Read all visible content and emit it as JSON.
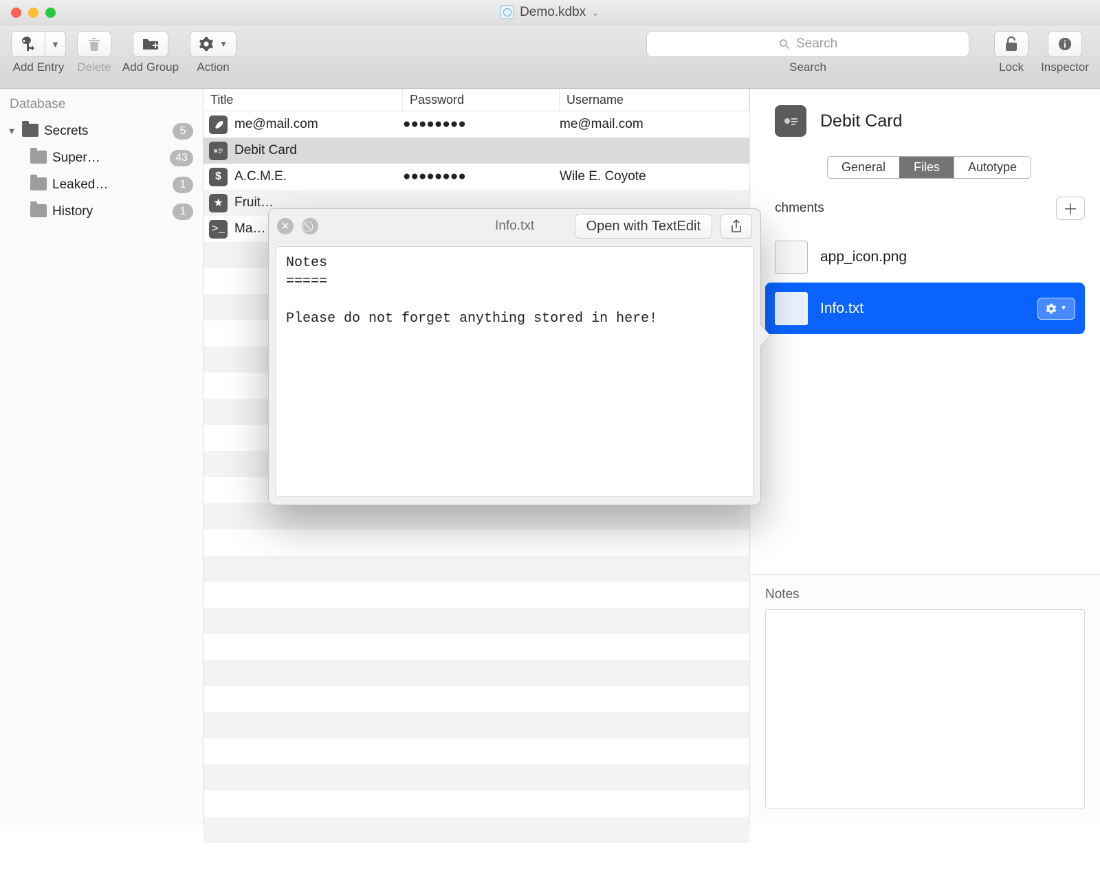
{
  "window": {
    "title": "Demo.kdbx"
  },
  "toolbar": {
    "add_entry": "Add Entry",
    "delete": "Delete",
    "add_group": "Add Group",
    "action": "Action",
    "search_placeholder": "Search",
    "search_label": "Search",
    "lock": "Lock",
    "inspector": "Inspector"
  },
  "sidebar": {
    "header": "Database",
    "root": {
      "label": "Secrets",
      "count": "5"
    },
    "children": [
      {
        "label": "Super…",
        "count": "43"
      },
      {
        "label": "Leaked…",
        "count": "1"
      },
      {
        "label": "History",
        "count": "1"
      }
    ]
  },
  "table": {
    "columns": {
      "title": "Title",
      "password": "Password",
      "username": "Username"
    },
    "rows": [
      {
        "icon": "feather",
        "title": "me@mail.com",
        "password": "●●●●●●●●",
        "username": "me@mail.com",
        "selected": false
      },
      {
        "icon": "card",
        "title": "Debit Card",
        "password": "",
        "username": "",
        "selected": true
      },
      {
        "icon": "dollar",
        "title": "A.C.M.E.",
        "password": "●●●●●●●●",
        "username": "Wile E. Coyote",
        "selected": false
      },
      {
        "icon": "star",
        "title": "Fruit…",
        "password": "",
        "username": "",
        "selected": false
      },
      {
        "icon": "term",
        "title": "Ma…",
        "password": "",
        "username": "",
        "selected": false
      }
    ]
  },
  "inspector": {
    "title": "Debit Card",
    "tabs": {
      "general": "General",
      "files": "Files",
      "autotype": "Autotype",
      "active": "files"
    },
    "attachments_label": "chments",
    "attachments": [
      {
        "name": "app_icon.png",
        "selected": false
      },
      {
        "name": "Info.txt",
        "selected": true
      }
    ],
    "notes_label": "Notes",
    "notes_value": ""
  },
  "popover": {
    "filename": "Info.txt",
    "open_with": "Open with TextEdit",
    "content": "Notes\n=====\n\nPlease do not forget anything stored in here!"
  }
}
